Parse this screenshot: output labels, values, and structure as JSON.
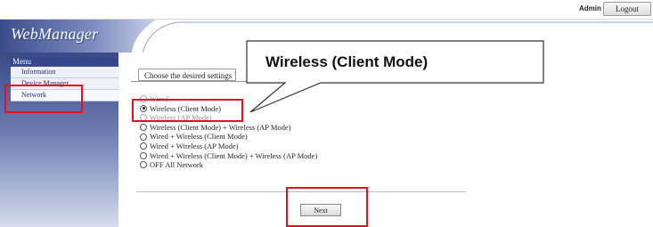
{
  "header": {
    "admin_label": "Admin",
    "logout_label": "Logout"
  },
  "brand": {
    "logo_text": "WebManager"
  },
  "sidebar": {
    "title": "Menu",
    "items": [
      {
        "label": "Information"
      },
      {
        "label": "Device Manager"
      },
      {
        "label": "Network"
      }
    ]
  },
  "main": {
    "tab_label": "Choose the desired settings",
    "options": [
      {
        "label": "Wired",
        "selected": false
      },
      {
        "label": "Wireless (Client Mode)",
        "selected": true
      },
      {
        "label": "Wireless (AP Mode)",
        "selected": false
      },
      {
        "label": "Wireless (Client Mode) + Wireless (AP Mode)",
        "selected": false
      },
      {
        "label": "Wired + Wireless (Client Mode)",
        "selected": false
      },
      {
        "label": "Wired + Wireless (AP Mode)",
        "selected": false
      },
      {
        "label": "Wired + Wireless (Client Mode) + Wireless (AP Mode)",
        "selected": false
      },
      {
        "label": "OFF All Network",
        "selected": false
      }
    ],
    "next_label": "Next"
  },
  "callout": {
    "text": "Wireless (Client Mode)"
  },
  "colors": {
    "highlight": "#e8101e",
    "sidebar_dark": "#3a4a86",
    "menu_text": "#1e2b66"
  }
}
